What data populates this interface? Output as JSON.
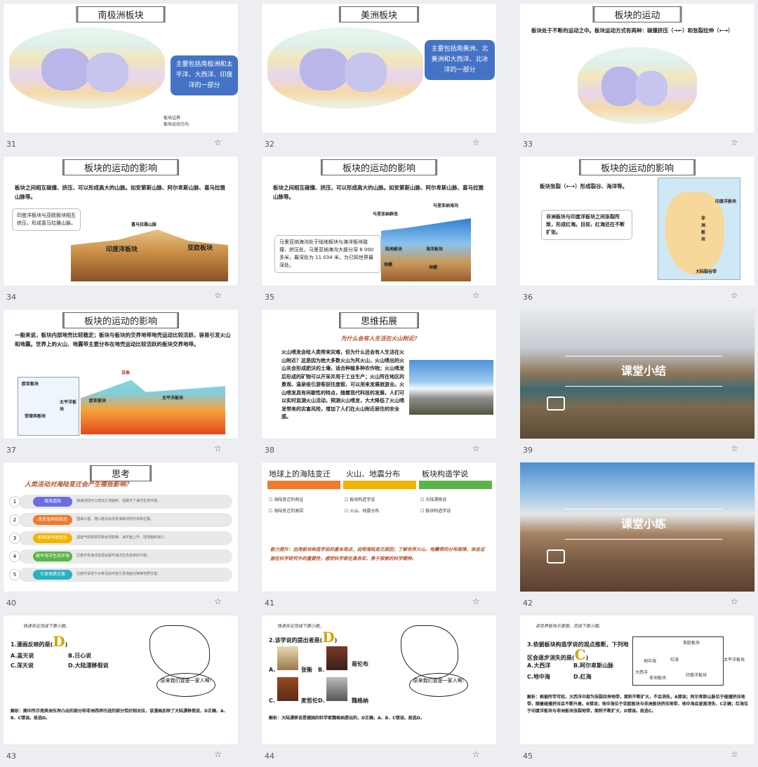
{
  "slides": [
    {
      "num": "31",
      "title": "南极洲板块",
      "callout": "主要包括南极洲和太平洋、大西洋、印度洋的一部分",
      "legend": [
        "板块边界",
        "板块运动方向"
      ]
    },
    {
      "num": "32",
      "title": "美洲板块",
      "callout": "主要包括南美洲、北美洲和大西洋、北冰洋的一部分"
    },
    {
      "num": "33",
      "title": "板块的运动",
      "text": "板块处于不断的运动之中。板块运动方式有两种：碰撞挤压（→←）和张裂拉伸（←→）"
    },
    {
      "num": "34",
      "title": "板块的运动的影响",
      "text": "板块之间相互碰撞、挤压，可以形成高大的山脉。如安第斯山脉、阿尔卑斯山脉、喜马拉雅山脉等。",
      "box": "印度洋板块与亚欧板块相互挤压，形成喜马拉雅山脉。",
      "labels": [
        "喜马拉雅山脉",
        "印度洋板块",
        "亚欧板块"
      ]
    },
    {
      "num": "35",
      "title": "板块的运动的影响",
      "text": "板块之间相互碰撞、挤压，可以形成高大的山脉。如安第斯山脉、阿尔卑斯山脉、喜马拉雅山脉等。",
      "box": "马里亚纳海沟处于陆地板块与海洋板块碰撞、挤压处，马里亚纳海沟大部分深 8 000 多米，最深处为 11 034 米，为已知世界最深处。",
      "labels": [
        "马里亚纳群岛",
        "马里亚纳海沟",
        "陆地板块",
        "海洋板块",
        "地幔",
        "地幔"
      ]
    },
    {
      "num": "36",
      "title": "板块的运动的影响",
      "text": "板块张裂（←→）形成裂谷、海洋等。",
      "box": "非洲板块与印度洋板块之间张裂所致，形成红海。目前，红海还在不断扩张。",
      "labels": [
        "印度洋板块",
        "非洲板块",
        "大陆裂谷带"
      ]
    },
    {
      "num": "37",
      "title": "板块的运动的影响",
      "text": "一般来说，板块内部地壳比较稳定；板块与板块的交界地带地壳运动比较活跃，容易引发火山和地震。世界上的火山、地震带主要分布在地壳运动比较活跃的板块交界地带。",
      "labels": [
        "欧亚板块",
        "太平洋板块",
        "菲律宾板块",
        "日本",
        "欧亚板块",
        "太平洋板块"
      ]
    },
    {
      "num": "38",
      "title": "思维拓展",
      "subtitle": "为什么会有人生活在火山附近?",
      "text": "火山喷发会给人类带来灾难，但为什么还会有人生活在火山附近？这是因为绝大多数火山为死火山，火山喷出的火山灰会形成肥沃的土壤，适合种植多种农作物；火山喷发后形成的矿物可以开采并用于工业生产；火山所在地区的景观、温泉吸引游客前往度假，可以用来发展旅游业。火山喷发具有间歇性的特点，随着现代科技的发展，人们可以实时监测火山活动，预测火山喷发，大大降低了火山喷发带来的灾害风险，增加了人们在火山附近居住的安全感。"
    },
    {
      "num": "39",
      "banner": "课堂小结"
    },
    {
      "num": "40",
      "title": "思考",
      "subtitle": "人类活动对海陆变迁会产生哪些影响?",
      "items": [
        {
          "n": "1",
          "label": "填海造陆",
          "color": "#6a6ee0",
          "desc": "填海造陆可以增加土地面积，但破坏了海洋生态环境。"
        },
        {
          "n": "2",
          "label": "改变海岸线形态",
          "color": "#f07b2a",
          "desc": "围海工程、港口建设会改变海岸线的形状和位置。"
        },
        {
          "n": "3",
          "label": "影响海平面变化",
          "color": "#f3b400",
          "desc": "温室气体排放导致全球变暖，海平面上升，陆地面积减少。"
        },
        {
          "n": "4",
          "label": "破坏海洋生态环境",
          "color": "#5ab44a",
          "desc": "过度开发海洋资源会破坏海洋生态系统的平衡。"
        },
        {
          "n": "5",
          "label": "引发地质灾害",
          "color": "#2bb0c0",
          "desc": "过度开采地下水等活动可能引发地面沉降等地质灾害。"
        }
      ]
    },
    {
      "num": "41",
      "headers": [
        "地球上的海陆变迁",
        "火山、地震分布",
        "板块构造学说"
      ],
      "header_colors": [
        "#f07b2a",
        "#f3b400",
        "#5ab44a"
      ],
      "items": [
        "海陆变迁的例证",
        "海陆变迁的原因",
        "板块构造学说",
        "火山、地震分布",
        "大陆漂移说",
        "板块构造学说"
      ],
      "goal": "能力提升：运用板块构造学说的基本观点，说明海陆变迁原因；了解世界火山、地震带的分布规律，体会证据在科学研究中的重要性，感受科学家在真务实、勇于探索的科学精神。"
    },
    {
      "num": "42",
      "banner": "课堂小练"
    },
    {
      "num": "43",
      "header": "快速反应完成下面小题。",
      "q": "1.漫画反映的是(",
      "ans": "D",
      "close": ")",
      "opts": [
        "A.盖天说",
        "B.日心说",
        "C.浑天说",
        "D.大陆漂移假说"
      ],
      "bubble": "原来我们曾是一家人啊!",
      "analysis": "解析：图中所示南美洲东岸凸出的部分和非洲西岸凹进的部分恰好相对应，该漫画反映了大陆漂移假说，D正确，A、B、C错误。故选D。"
    },
    {
      "num": "44",
      "header": "快速反应完成下面小题。",
      "q": "2.该学说的提出者是(",
      "ans": "D",
      "close": ")",
      "names": [
        "张衡",
        "哥伦布",
        "麦哲伦",
        "魏格纳"
      ],
      "letters": [
        "A.",
        "B.",
        "C.",
        "D."
      ],
      "bubble": "原来我们曾是一家人啊!",
      "analysis": "解析：大陆漂移说是德国的科学家魏格纳提出的，D正确，A、B、C错误。故选D。"
    },
    {
      "num": "45",
      "header": "读世界板块示意图，完成下面小题。",
      "q": "3.依据板块构造学说的观点推断，下列地区会逐步消失的是(",
      "ans": "C",
      "close": ")",
      "opts": [
        "A.大西洋",
        "B.阿尔卑斯山脉",
        "C.地中海",
        "D.红海"
      ],
      "map_labels": [
        "亚欧板块",
        "地中海",
        "红海",
        "大西洋",
        "非洲板块",
        "印度洋板块",
        "太平洋板块"
      ],
      "analysis": "解析：根据所学可知，大西洋中部为张裂拉伸地带，面积不断扩大，不会消失，A错误；阿尔卑斯山脉位于碰撞挤压地带，随着碰撞挤压会不断升高，B错误；地中海位于亚欧板块与非洲板块挤压地带，地中海会逐渐消失，C正确；红海位于印度洋板块与非洲板块张裂地带，面积不断扩大，D错误。故选C。"
    }
  ],
  "star_icon": "☆"
}
